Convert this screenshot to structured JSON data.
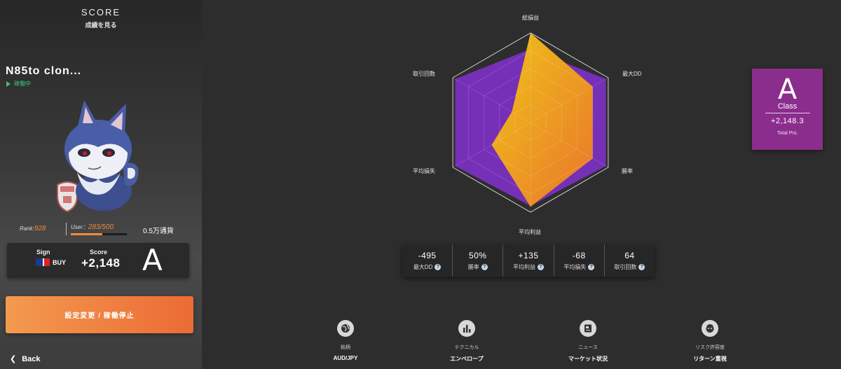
{
  "header": {
    "title": "SCORE",
    "subtitle": "成績を見る"
  },
  "bot": {
    "name": "N85to clon...",
    "status": "稼働中"
  },
  "stats": {
    "rank_label": "Rank:",
    "rank_value": "928",
    "user_label": "User：",
    "user_value": "283/500",
    "user_progress": 0.566,
    "currency": "0.5万通貨"
  },
  "sign_card": {
    "sign_label": "Sign",
    "sign_value": "BUY",
    "score_label": "Score",
    "score_value": "+2,148",
    "grade": "A"
  },
  "action_button": {
    "label": "設定変更 / 稼働停止"
  },
  "back": {
    "label": "Back"
  },
  "radar": {
    "labels": {
      "top": "総損益",
      "top_right": "最大DD",
      "bottom_right": "勝率",
      "bottom": "平均利益",
      "bottom_left": "平均損失",
      "top_left": "取引回数"
    },
    "purple_values": [
      0.82,
      0.97,
      0.97,
      0.93,
      0.97,
      0.97
    ],
    "yellow_values": [
      1.0,
      0.8,
      0.8,
      0.94,
      0.5,
      0.24
    ],
    "colors": {
      "outer": "#7a2fbf",
      "inner_a": "#f0c419",
      "inner_b": "#e9762a"
    }
  },
  "metrics": [
    {
      "value": "-495",
      "label": "最大DD"
    },
    {
      "value": "50%",
      "label": "勝率"
    },
    {
      "value": "+135",
      "label": "平均利益"
    },
    {
      "value": "-68",
      "label": "平均損失"
    },
    {
      "value": "64",
      "label": "取引回数"
    }
  ],
  "class_card": {
    "grade": "A",
    "label": "Class",
    "pnl": "+2,148.3",
    "pnl_label": "Total PnL"
  },
  "bottom_nav": [
    {
      "label": "銘柄",
      "value": "AUD/JPY",
      "icon": "globe-icon"
    },
    {
      "label": "テクニカル",
      "value": "エンベロープ",
      "icon": "bar-chart-icon"
    },
    {
      "label": "ニュース",
      "value": "マーケット状況",
      "icon": "news-icon"
    },
    {
      "label": "リスク許容度",
      "value": "リターン重視",
      "icon": "face-icon"
    }
  ]
}
